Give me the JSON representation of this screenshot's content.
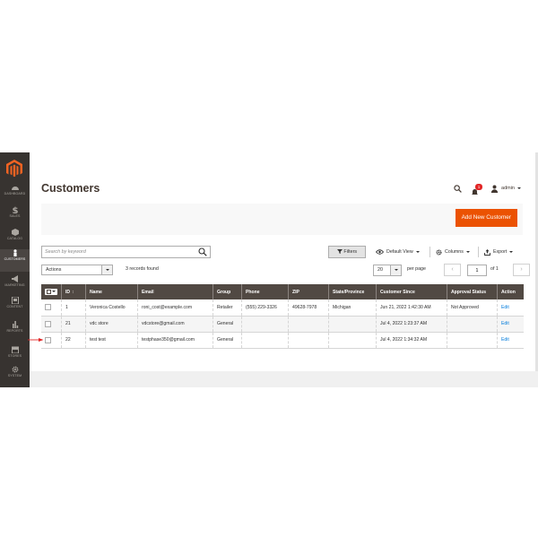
{
  "colors": {
    "accent": "#eb5202",
    "sidebar": "#373330",
    "table_header": "#514943",
    "link": "#007bdb",
    "annotation_arrow": "#e22626"
  },
  "sidebar": {
    "items": [
      {
        "label": "DASHBOARD",
        "icon": "dashboard-icon"
      },
      {
        "label": "SALES",
        "icon": "dollar-icon"
      },
      {
        "label": "CATALOG",
        "icon": "cube-icon"
      },
      {
        "label": "CUSTOMERS",
        "icon": "person-icon",
        "active": true
      },
      {
        "label": "MARKETING",
        "icon": "megaphone-icon"
      },
      {
        "label": "CONTENT",
        "icon": "content-icon"
      },
      {
        "label": "REPORTS",
        "icon": "bar-chart-icon"
      },
      {
        "label": "STORES",
        "icon": "store-icon"
      },
      {
        "label": "SYSTEM",
        "icon": "gear-icon"
      }
    ]
  },
  "header": {
    "title": "Customers",
    "notification_count": "1",
    "user": "admin"
  },
  "actions": {
    "add_new": "Add New Customer"
  },
  "search": {
    "placeholder": "Search by keyword",
    "value": ""
  },
  "toolbar": {
    "filters": "Filters",
    "default_view": "Default View",
    "columns": "Columns",
    "export": "Export"
  },
  "mass_actions": {
    "label": "Actions"
  },
  "records_found": "3 records found",
  "pagination": {
    "per_page_value": "20",
    "per_page_label": "per page",
    "current_page": "1",
    "of_pages": "of 1"
  },
  "table": {
    "columns": [
      "ID",
      "Name",
      "Email",
      "Group",
      "Phone",
      "ZIP",
      "State/Province",
      "Customer Since",
      "Approval Status",
      "Action"
    ],
    "rows": [
      {
        "id": "1",
        "name": "Veronica Costello",
        "email": "roni_cost@example.com",
        "group": "Retailer",
        "phone": "(555) 229-3326",
        "zip": "49628-7978",
        "state": "Michigan",
        "since": "Jun 21, 2022 1:42:30 AM",
        "approval": "Not Approved",
        "action": "Edit"
      },
      {
        "id": "21",
        "name": "vdc store",
        "email": "vdcstore@gmail.com",
        "group": "General",
        "phone": "",
        "zip": "",
        "state": "",
        "since": "Jul 4, 2022 1:23:37 AM",
        "approval": "",
        "action": "Edit"
      },
      {
        "id": "22",
        "name": "test test",
        "email": "testphase350@gmail.com",
        "group": "General",
        "phone": "",
        "zip": "",
        "state": "",
        "since": "Jul 4, 2022 1:34:32 AM",
        "approval": "",
        "action": "Edit"
      }
    ]
  }
}
